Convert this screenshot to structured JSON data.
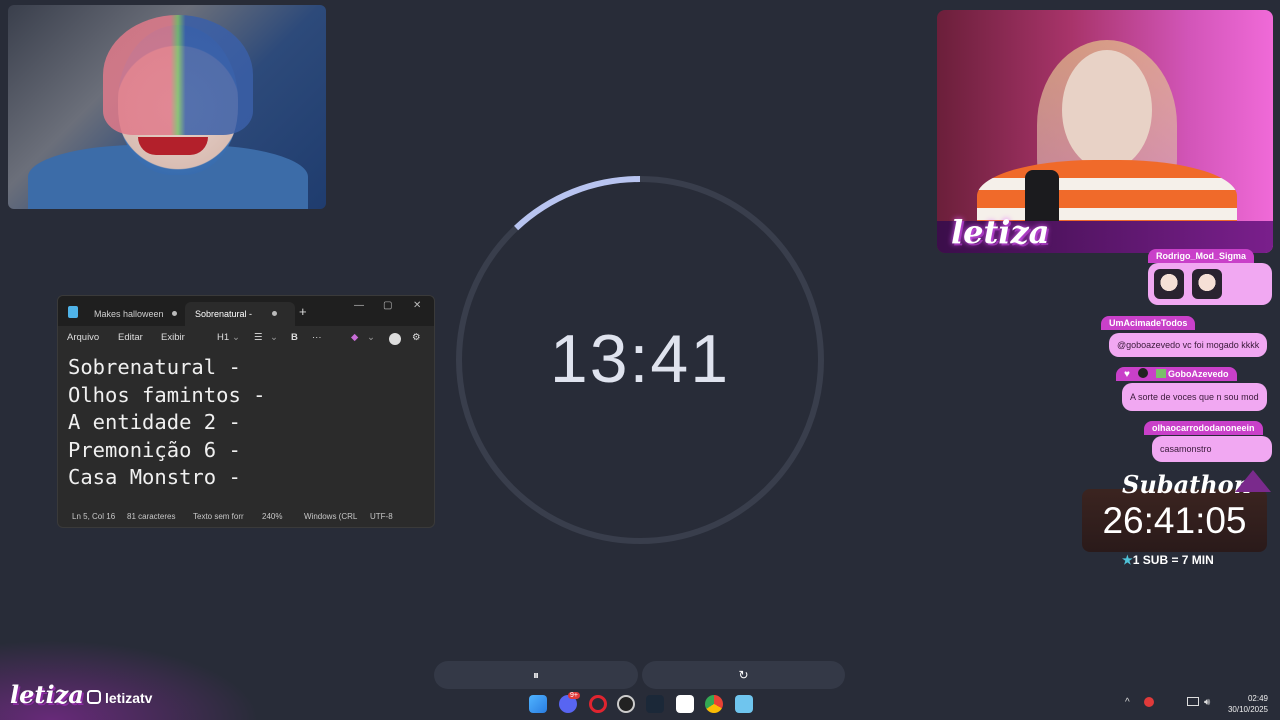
{
  "webcams": {
    "left": {
      "label": "webcam-left"
    },
    "right": {
      "logo_text": "letiza"
    }
  },
  "timer": {
    "time": "13:41",
    "progress": 0.12
  },
  "notepad": {
    "tabs": [
      {
        "label": "Makes halloween",
        "active": false
      },
      {
        "label": "Sobrenatural -",
        "active": true
      }
    ],
    "new_tab_label": "+",
    "window_buttons": {
      "minimize": "—",
      "maximize": "▢",
      "close": "✕"
    },
    "menu": {
      "file": "Arquivo",
      "edit": "Editar",
      "view": "Exibir",
      "heading": "H1",
      "bold": "B",
      "more": "···"
    },
    "lines": [
      "Sobrenatural -",
      "Olhos famintos -",
      "A entidade 2 -",
      "Premonição 6 -",
      "Casa Monstro -"
    ],
    "status": {
      "position": "Ln 5, Col 16",
      "chars": "81 caracteres",
      "format": "Texto sem forr",
      "zoom": "240%",
      "line_ending": "Windows (CRL",
      "encoding": "UTF-8"
    }
  },
  "chat": [
    {
      "user": "Rodrigo_Mod_Sigma",
      "message": ""
    },
    {
      "user": "UmAcimadeTodos",
      "message": "@goboazevedo vc foi mogado kkkk"
    },
    {
      "user": "GoboAzevedo",
      "message": "A sorte de voces que n sou mod"
    },
    {
      "user": "olhaocarrododanoneein",
      "message": "casamonstro"
    }
  ],
  "subathon": {
    "title": "Subathon",
    "time": "26:41:05",
    "rule": "1 SUB = 7 MIN"
  },
  "controls": {
    "pause": "⏸",
    "reset": "↻"
  },
  "branding": {
    "logo": "letiza",
    "instagram": "letizatv"
  },
  "taskbar": {
    "icons": [
      "windows-start-icon",
      "discord-icon",
      "opera-icon",
      "obs-icon",
      "steam-icon",
      "capcut-icon",
      "chrome-icon",
      "notepad-icon"
    ],
    "discord_badge": "9+",
    "tray": {
      "chevron": "^",
      "wifi": "wifi",
      "volume": "vol"
    },
    "time": "02:49",
    "date": "30/10/2025"
  },
  "colors": {
    "background": "#282c38",
    "accent": "#c940c9",
    "timer_progress": "#b8c4f0"
  }
}
